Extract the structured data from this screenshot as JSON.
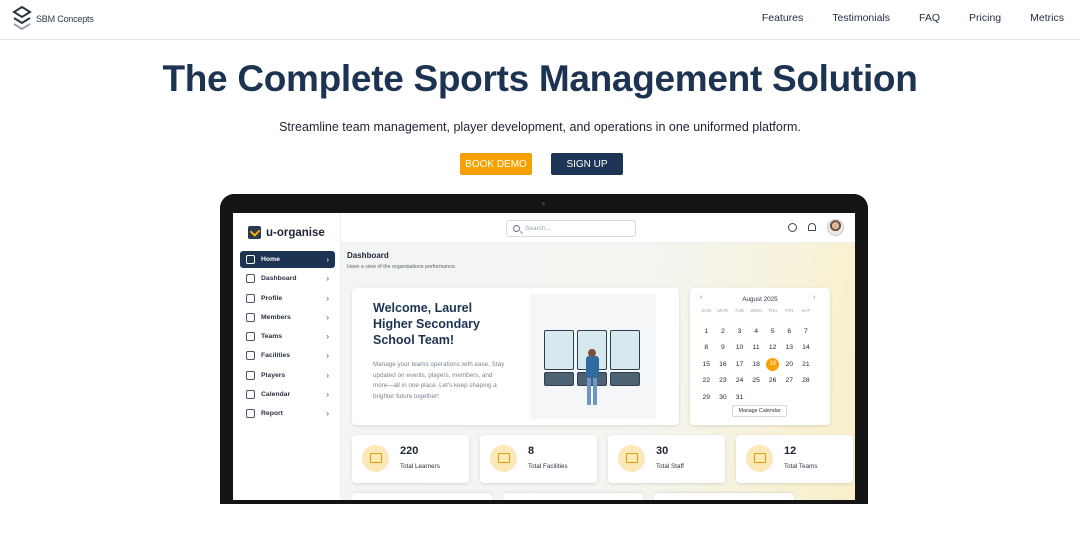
{
  "header": {
    "brand": "SBM Concepts",
    "nav": [
      "Features",
      "Testimonials",
      "FAQ",
      "Pricing",
      "Metrics"
    ]
  },
  "hero": {
    "title": "The Complete Sports Management Solution",
    "subtitle": "Streamline team management, player development, and operations in one uniformed platform.",
    "demo_label": "BOOK DEMO",
    "signup_label": "SIGN UP",
    "colors": {
      "title": "#1d3352",
      "demo": "#f6a100",
      "signup": "#1c3554"
    }
  },
  "app": {
    "name": "u-organise",
    "search_placeholder": "Search...",
    "menu": [
      {
        "label": "Home",
        "icon": "home-icon",
        "active": true
      },
      {
        "label": "Dashboard",
        "icon": "dashboard-icon"
      },
      {
        "label": "Profile",
        "icon": "user-icon"
      },
      {
        "label": "Members",
        "icon": "members-icon"
      },
      {
        "label": "Teams",
        "icon": "teams-icon"
      },
      {
        "label": "Facilities",
        "icon": "facilities-icon"
      },
      {
        "label": "Players",
        "icon": "players-icon"
      },
      {
        "label": "Calendar",
        "icon": "calendar-icon"
      },
      {
        "label": "Report",
        "icon": "report-icon"
      }
    ],
    "page_title": "Dashboard",
    "page_subtitle": "Have a view of the organisations performance.",
    "welcome": {
      "title": "Welcome, Laurel Higher Secondary School Team!",
      "text": "Manage your teams operations with ease. Stay updated on events, players, members, and more—all in one place. Let's keep shaping a brighter future together!"
    },
    "calendar": {
      "month": "August 2025",
      "weekdays": [
        "SUN",
        "MON",
        "TUE",
        "WED",
        "THU",
        "FRI",
        "SAT"
      ],
      "days": [
        "1",
        "2",
        "3",
        "4",
        "5",
        "6",
        "7",
        "8",
        "9",
        "10",
        "11",
        "12",
        "13",
        "14",
        "15",
        "16",
        "17",
        "18",
        "19",
        "20",
        "21",
        "22",
        "23",
        "24",
        "25",
        "26",
        "27",
        "28",
        "29",
        "30",
        "31"
      ],
      "today": "19",
      "button": "Manage Calendar"
    },
    "stats": [
      {
        "value": "220",
        "label": "Total Learners"
      },
      {
        "value": "8",
        "label": "Total Facilities"
      },
      {
        "value": "30",
        "label": "Total Staff"
      },
      {
        "value": "12",
        "label": "Total Teams"
      }
    ]
  }
}
